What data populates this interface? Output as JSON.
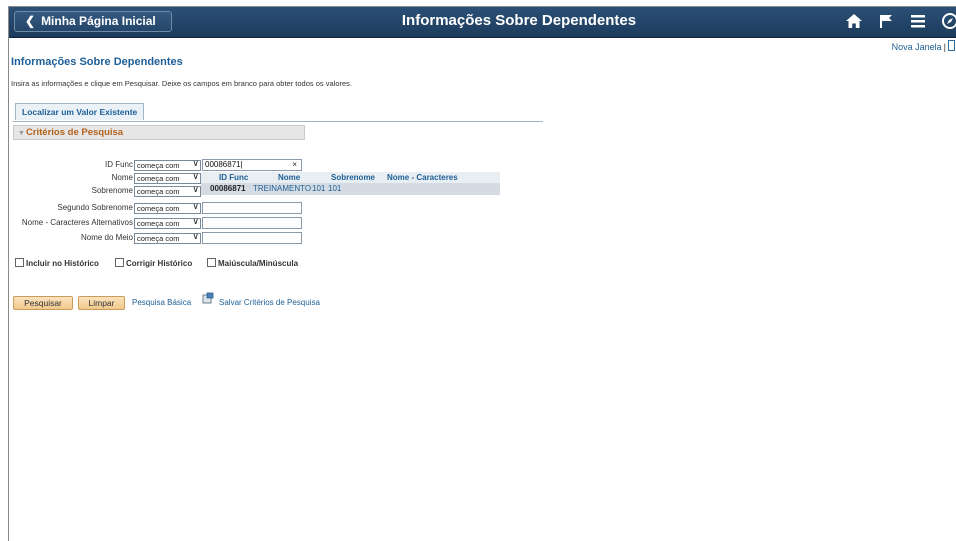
{
  "banner": {
    "home_label": "Minha Página Inicial",
    "title": "Informações Sobre Dependentes",
    "icons": [
      "home-icon",
      "flag-icon",
      "menu-icon",
      "compass-icon"
    ]
  },
  "nova_janela": "Nova Janela",
  "nova_sep": "|",
  "page_title": "Informações Sobre Dependentes",
  "instructions": "Insira as informações e clique em Pesquisar. Deixe os campos em branco para obter todos os valores.",
  "tab_label": "Localizar um Valor Existente",
  "section_title": "Critérios de Pesquisa",
  "fields": [
    {
      "label": "ID Func",
      "operator": "começa com",
      "value": "00086871"
    },
    {
      "label": "Nome",
      "operator": "começa com",
      "value": ""
    },
    {
      "label": "Sobrenome",
      "operator": "começa com",
      "value": ""
    },
    {
      "label": "Segundo Sobrenome",
      "operator": "começa com",
      "value": ""
    },
    {
      "label": "Nome - Caracteres Alternativos",
      "operator": "começa com",
      "value": ""
    },
    {
      "label": "Nome do Meio",
      "operator": "começa com",
      "value": ""
    }
  ],
  "clear_symbol": "×",
  "dropdown": {
    "headers": [
      "ID Func",
      "Nome",
      "Sobrenome",
      "Nome - Caracteres Alternativos"
    ],
    "row": {
      "id": "00086871",
      "nome": "TREINAMENTO",
      "sobrenome": "101",
      "alt": "101"
    }
  },
  "checkboxes": [
    {
      "label": "Incluir no Histórico",
      "checked": false
    },
    {
      "label": "Corrigir Histórico",
      "checked": false
    },
    {
      "label": "Maiúscula/Minúscula",
      "checked": false
    }
  ],
  "buttons": {
    "search": "Pesquisar",
    "clear": "Limpar"
  },
  "links": {
    "basic": "Pesquisa Básica",
    "save": "Salvar Critérios de Pesquisa"
  },
  "colors": {
    "banner": "#24466a",
    "link": "#1d5f96",
    "section_title": "#b3621a",
    "button": "#f2c98c"
  }
}
